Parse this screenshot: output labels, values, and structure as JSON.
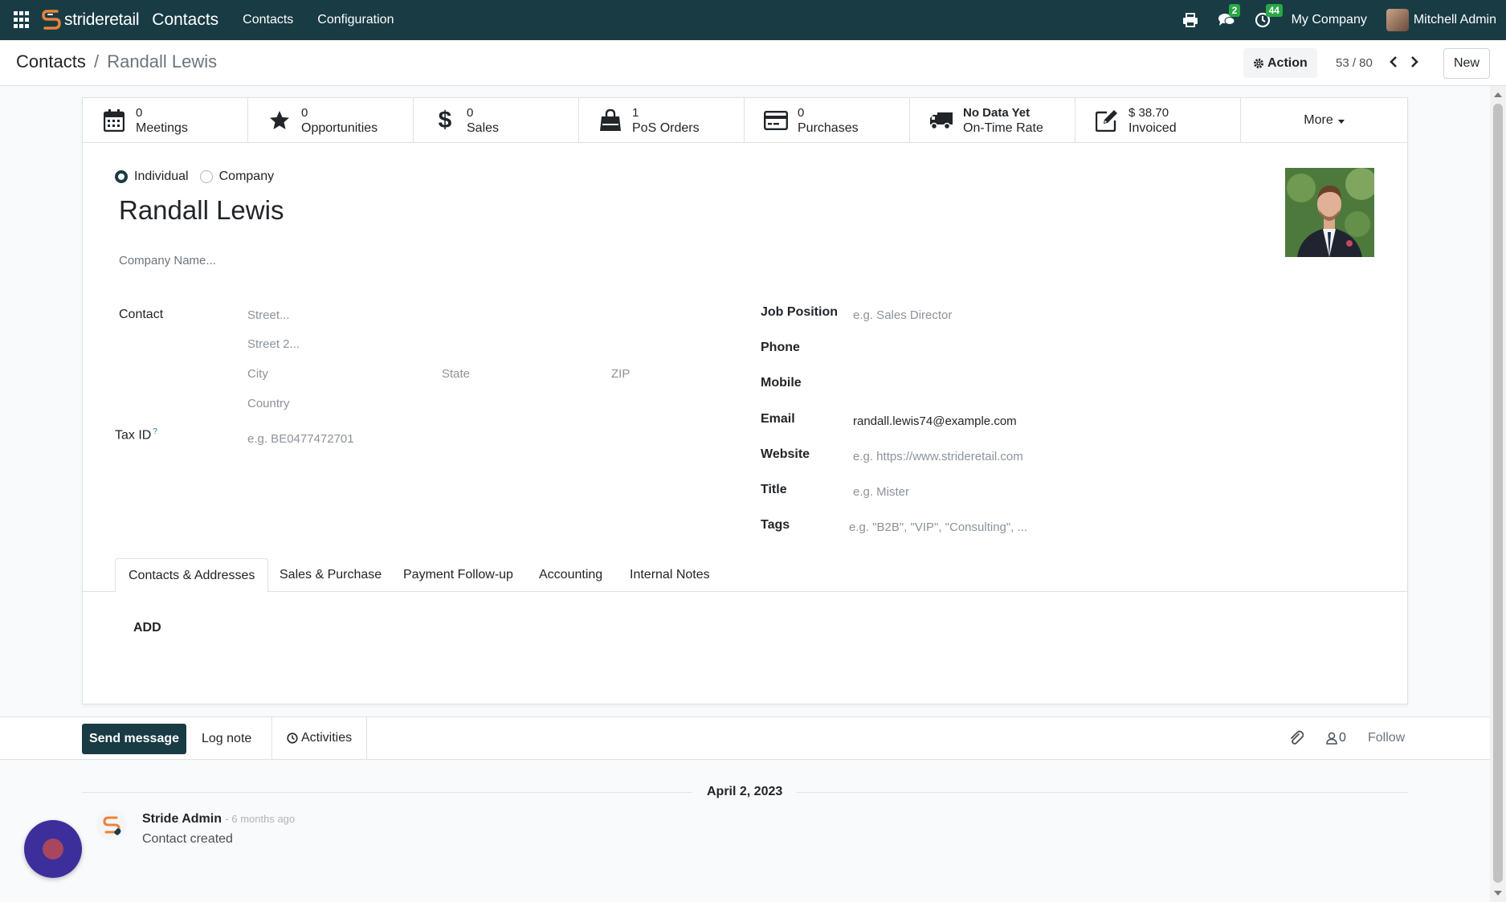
{
  "navbar": {
    "brand_prefix": "stride",
    "brand_suffix": "retail",
    "app_name": "Contacts",
    "menu": [
      "Contacts",
      "Configuration"
    ],
    "messages_badge": "2",
    "activities_badge": "44",
    "company": "My Company",
    "user": "Mitchell Admin"
  },
  "control": {
    "breadcrumb_parent": "Contacts",
    "breadcrumb_separator": "/",
    "breadcrumb_current": "Randall Lewis",
    "action_label": "Action",
    "pager": "53 / 80",
    "new_label": "New"
  },
  "stats": [
    {
      "icon": "calendar-icon",
      "value": "0",
      "label": "Meetings"
    },
    {
      "icon": "star-icon",
      "value": "0",
      "label": "Opportunities"
    },
    {
      "icon": "dollar-icon",
      "value": "0",
      "label": "Sales"
    },
    {
      "icon": "shopping-bag-icon",
      "value": "1",
      "label": "PoS Orders"
    },
    {
      "icon": "credit-card-icon",
      "value": "0",
      "label": "Purchases"
    },
    {
      "icon": "truck-icon",
      "value": "No Data Yet",
      "label": "On-Time Rate"
    },
    {
      "icon": "edit-icon",
      "value": "$ 38.70",
      "label": "Invoiced"
    }
  ],
  "more_label": "More",
  "form": {
    "type_individual": "Individual",
    "type_company": "Company",
    "selected_type": "Individual",
    "name": "Randall Lewis",
    "company_placeholder": "Company Name...",
    "contact_label": "Contact",
    "street_placeholder": "Street...",
    "street2_placeholder": "Street 2...",
    "city_placeholder": "City",
    "state_placeholder": "State",
    "zip_placeholder": "ZIP",
    "country_placeholder": "Country",
    "taxid_label": "Tax ID",
    "taxid_help": "?",
    "taxid_placeholder": "e.g. BE0477472701",
    "job_label": "Job Position",
    "job_placeholder": "e.g. Sales Director",
    "phone_label": "Phone",
    "mobile_label": "Mobile",
    "email_label": "Email",
    "email_value": "randall.lewis74@example.com",
    "website_label": "Website",
    "website_placeholder": "e.g. https://www.strideretail.com",
    "title_label": "Title",
    "title_placeholder": "e.g. Mister",
    "tags_label": "Tags",
    "tags_placeholder": "e.g. \"B2B\", \"VIP\", \"Consulting\", ..."
  },
  "tabs": [
    "Contacts & Addresses",
    "Sales & Purchase",
    "Payment Follow-up",
    "Accounting",
    "Internal Notes"
  ],
  "active_tab": "Contacts & Addresses",
  "add_label": "ADD",
  "chatter": {
    "send_label": "Send message",
    "log_label": "Log note",
    "activities_label": "Activities",
    "followers_count": "0",
    "follow_label": "Follow",
    "date": "April 2, 2023",
    "author": "Stride Admin",
    "time": "- 6 months ago",
    "body": "Contact created"
  },
  "colors": {
    "navbar": "#183b44",
    "primary": "#183b44",
    "badge": "#28a745",
    "fab": "#3c2f9c"
  }
}
